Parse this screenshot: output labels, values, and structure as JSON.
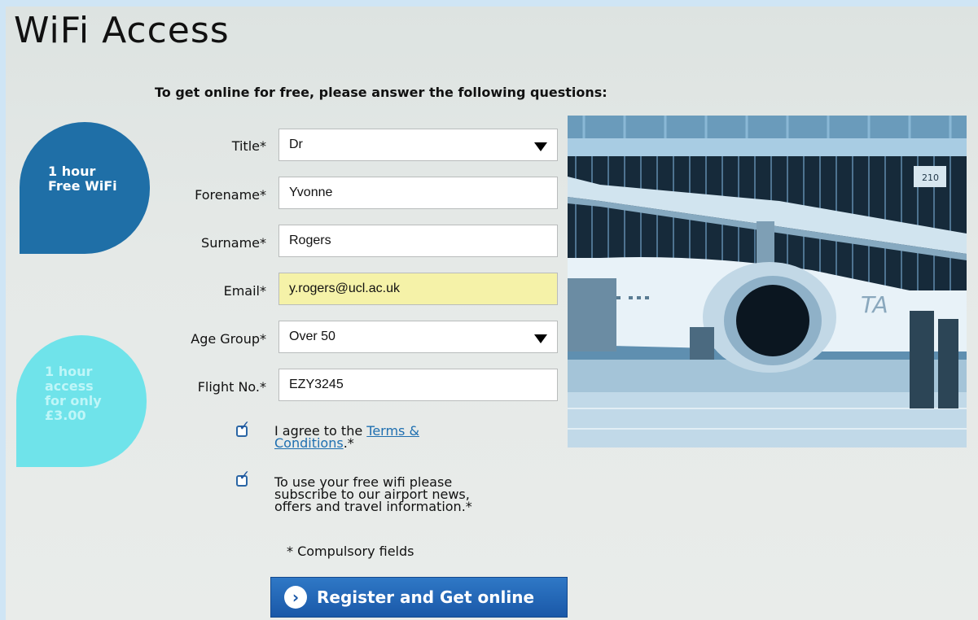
{
  "page": {
    "title": "WiFi Access"
  },
  "instructions": "To get online for free, please answer the following questions:",
  "promos": {
    "free": {
      "line1": "1 hour",
      "line2": "Free WiFi",
      "color": "#1f6fa7"
    },
    "paid": {
      "line1": "1 hour",
      "line2": "access",
      "line3": "for only",
      "line4": "£3.00",
      "color": "#6fe3ea"
    }
  },
  "form": {
    "title": {
      "label": "Title*",
      "value": "Dr"
    },
    "forename": {
      "label": "Forename*",
      "value": "Yvonne"
    },
    "surname": {
      "label": "Surname*",
      "value": "Rogers"
    },
    "email": {
      "label": "Email*",
      "value": "y.rogers@ucl.ac.uk"
    },
    "age_group": {
      "label": "Age Group*",
      "value": "Over 50"
    },
    "flight_no": {
      "label": "Flight No.*",
      "value": "EZY3245"
    },
    "terms": {
      "checked": true,
      "text_before": "I agree to the ",
      "link_line1": "Terms &",
      "link_line2": "Conditions",
      "text_after": ".*"
    },
    "subscribe": {
      "checked": true,
      "line1": "To use your free wifi please",
      "line2": "subscribe to our airport news,",
      "line3": "offers and travel information.*"
    },
    "compulsory_note": "* Compulsory fields",
    "submit_label": "Register and Get online"
  },
  "image": {
    "subject": "airplane-at-terminal",
    "hangar_number": "210"
  },
  "colors": {
    "accent": "#1a58a8",
    "link": "#1f6fb0",
    "highlight_field": "#f5f2a8"
  }
}
